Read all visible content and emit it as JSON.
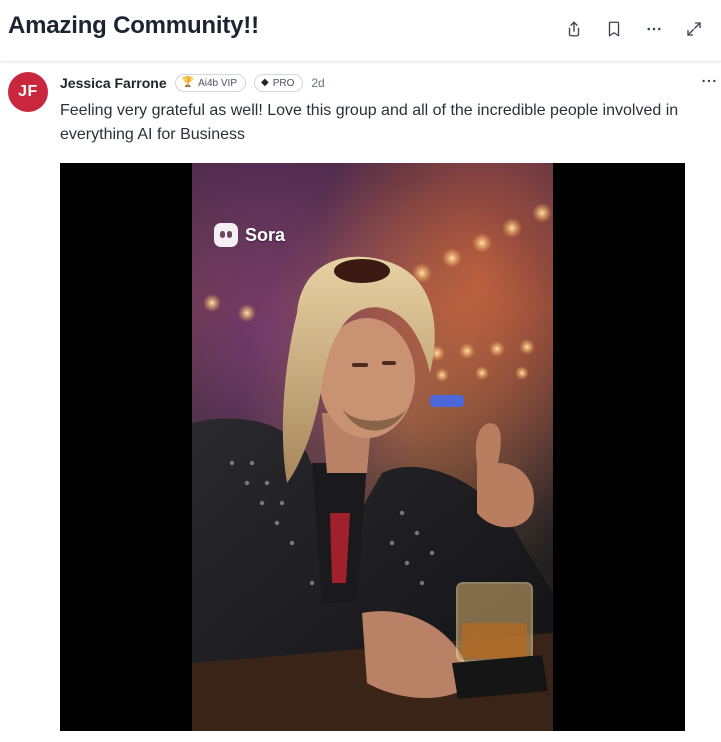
{
  "header": {
    "title": "Amazing Community!!",
    "actions": {
      "share_icon": "share-icon",
      "bookmark_icon": "bookmark-icon",
      "more_icon": "more-horizontal-icon",
      "expand_icon": "expand-icon"
    }
  },
  "post": {
    "author": {
      "initials": "JF",
      "name": "Jessica Farrone",
      "avatar_color": "#c8273d"
    },
    "badges": [
      {
        "label": "Ai4b VIP",
        "icon": "trophy-icon"
      },
      {
        "label": "PRO",
        "icon": "shield-icon"
      }
    ],
    "timestamp": "2d",
    "menu_icon": "ellipsis-icon",
    "body": "Feeling very grateful as well! Love this group and all of the incredible people involved in everything AI for Business",
    "video": {
      "watermark": "Sora"
    }
  }
}
